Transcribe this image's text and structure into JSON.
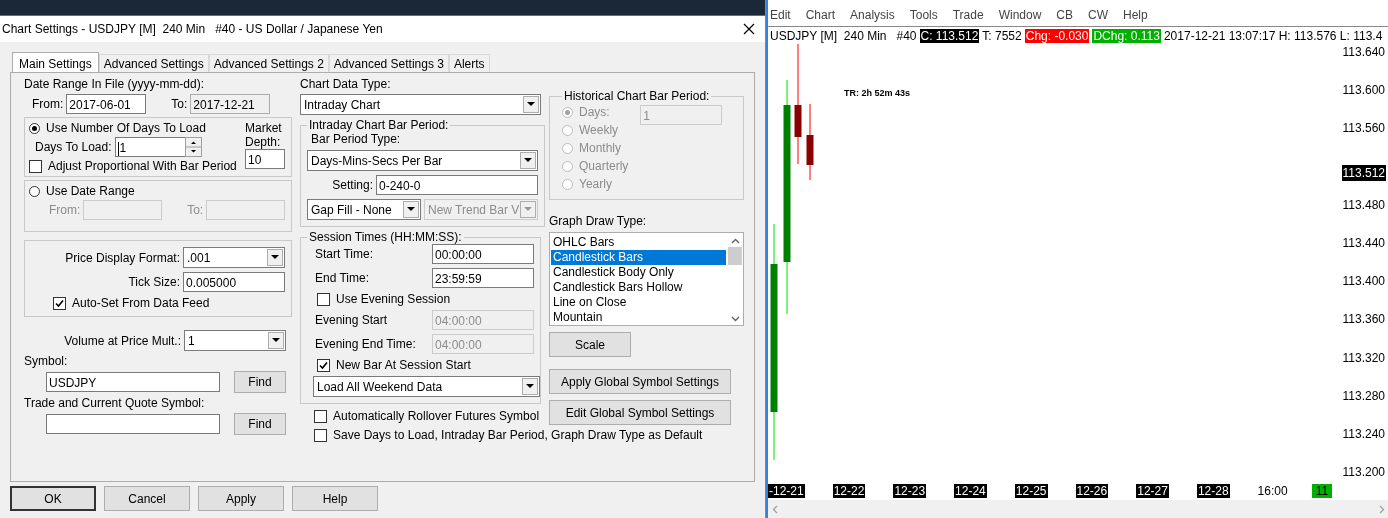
{
  "dialog": {
    "title": "Chart Settings - USDJPY [M]  240 Min   #40 - US Dollar / Japanese Yen",
    "tabs": [
      {
        "label": "Main Settings",
        "selected": true
      },
      {
        "label": "Advanced Settings",
        "selected": false
      },
      {
        "label": "Advanced Settings 2",
        "selected": false
      },
      {
        "label": "Advanced Settings 3",
        "selected": false
      },
      {
        "label": "Alerts",
        "selected": false
      }
    ],
    "date_range": {
      "label": "Date Range In File (yyyy-mm-dd):",
      "from_label": "From:",
      "from": "2017-06-01",
      "to_label": "To:",
      "to": "2017-12-21"
    },
    "days_group": {
      "radio_label": "Use Number Of Days To Load",
      "selected": true,
      "days_label": "Days To Load:",
      "days": "1",
      "adjust_label": "Adjust Proportional With Bar Period",
      "adjust_checked": false,
      "depth_label_1": "Market",
      "depth_label_2": "Depth:",
      "depth": "10"
    },
    "range_group": {
      "radio_label": "Use Date Range",
      "selected": false,
      "from_label": "From:",
      "to_label": "To:"
    },
    "price_group": {
      "format_label": "Price Display Format:",
      "format": ".001",
      "tick_label": "Tick Size:",
      "tick": "0.005000",
      "auto_label": "Auto-Set From Data Feed",
      "auto_checked": true
    },
    "volume": {
      "label": "Volume at Price Mult.:",
      "value": "1"
    },
    "symbol": {
      "label": "Symbol:",
      "value": "USDJPY",
      "find": "Find"
    },
    "quote_symbol": {
      "label": "Trade and Current Quote Symbol:",
      "find": "Find"
    },
    "chart_data_type": {
      "label": "Chart Data Type:",
      "value": "Intraday Chart"
    },
    "intraday": {
      "legend": "Intraday Chart Bar Period:",
      "type_label": "Bar Period Type:",
      "type": "Days-Mins-Secs Per Bar",
      "setting_label": "Setting:",
      "setting": "0-240-0",
      "gap_fill": "Gap Fill - None",
      "trend": "New Trend Bar V"
    },
    "session": {
      "legend": "Session Times (HH:MM:SS):",
      "items": [
        {
          "kind": "field",
          "label": "Start Time:",
          "value": "00:00:00",
          "disabled": false
        },
        {
          "kind": "field",
          "label": "End Time:",
          "value": "23:59:59",
          "disabled": false
        },
        {
          "kind": "checkbox",
          "label": "Use Evening Session",
          "checked": false
        },
        {
          "kind": "field",
          "label": "Evening Start",
          "value": "04:00:00",
          "disabled": true
        },
        {
          "kind": "field",
          "label": "Evening End Time:",
          "value": "04:00:00",
          "disabled": true
        },
        {
          "kind": "checkbox",
          "label": "New Bar At Session Start",
          "checked": true
        },
        {
          "kind": "select",
          "value": "Load All Weekend Data"
        }
      ]
    },
    "bottom_checks": [
      {
        "label": "Automatically Rollover Futures Symbol",
        "checked": false
      },
      {
        "label": "Save Days to Load, Intraday Bar Period, Graph Draw Type as Default",
        "checked": false
      }
    ],
    "historical": {
      "legend": "Historical Chart Bar Period:",
      "days_value": "1",
      "options": [
        {
          "label": "Days:",
          "selected": true
        },
        {
          "label": "Weekly",
          "selected": false
        },
        {
          "label": "Monthly",
          "selected": false
        },
        {
          "label": "Quarterly",
          "selected": false
        },
        {
          "label": "Yearly",
          "selected": false
        }
      ]
    },
    "graph_draw_type": {
      "label": "Graph Draw Type:",
      "items": [
        {
          "label": "OHLC Bars",
          "selected": false
        },
        {
          "label": "Candlestick Bars",
          "selected": true
        },
        {
          "label": "Candlestick Body Only",
          "selected": false
        },
        {
          "label": "Candlestick Bars Hollow",
          "selected": false
        },
        {
          "label": "Line on Close",
          "selected": false
        },
        {
          "label": "Mountain",
          "selected": false
        }
      ]
    },
    "scale_button": "Scale",
    "global_buttons": [
      "Apply Global Symbol Settings",
      "Edit Global Symbol Settings"
    ],
    "footer_buttons": [
      "OK",
      "Cancel",
      "Apply",
      "Help"
    ]
  },
  "chart": {
    "menu": [
      "Edit",
      "Chart",
      "Analysis",
      "Tools",
      "Trade",
      "Window",
      "CB",
      "CW",
      "Help"
    ],
    "info": [
      {
        "text": "USDJPY [M]  240 Min   #40",
        "kind": "plain"
      },
      {
        "text": "C: 113.512",
        "kind": "price"
      },
      {
        "text": "T: 7552",
        "kind": "plain"
      },
      {
        "text": "Chg: -0.030",
        "kind": "down"
      },
      {
        "text": "DChg: 0.113",
        "kind": "up"
      },
      {
        "text": "2017-12-21 13:07:17 H: 113.576 L: 113.4",
        "kind": "plain"
      }
    ],
    "timer": "TR: 2h 52m 43s",
    "price_labels": [
      {
        "text": "113.640",
        "kind": "tick"
      },
      {
        "text": "113.600",
        "kind": "tick"
      },
      {
        "text": "113.560",
        "kind": "tick"
      },
      {
        "text": "113.512",
        "kind": "current"
      },
      {
        "text": "113.480",
        "kind": "tick"
      },
      {
        "text": "113.440",
        "kind": "tick"
      },
      {
        "text": "113.400",
        "kind": "tick"
      },
      {
        "text": "113.360",
        "kind": "tick"
      },
      {
        "text": "113.320",
        "kind": "tick"
      },
      {
        "text": "113.280",
        "kind": "tick"
      },
      {
        "text": "113.240",
        "kind": "tick"
      },
      {
        "text": "113.200",
        "kind": "tick"
      }
    ],
    "time_labels": [
      {
        "text": "-12-21",
        "kind": "date"
      },
      {
        "text": "12-22",
        "kind": "date"
      },
      {
        "text": "12-23",
        "kind": "date"
      },
      {
        "text": "12-24",
        "kind": "date"
      },
      {
        "text": "12-25",
        "kind": "date"
      },
      {
        "text": "12-26",
        "kind": "date"
      },
      {
        "text": "12-27",
        "kind": "date"
      },
      {
        "text": "12-28",
        "kind": "date"
      },
      {
        "text": "16:00",
        "kind": "time"
      },
      {
        "text": "11",
        "kind": "live"
      }
    ]
  }
}
